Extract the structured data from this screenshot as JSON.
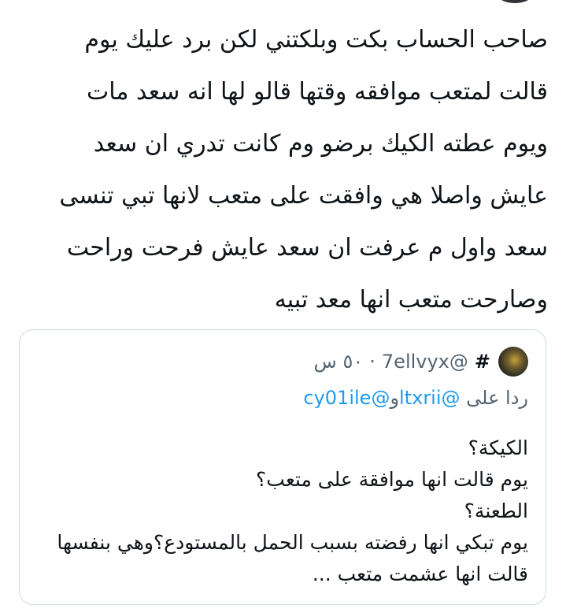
{
  "tweet": {
    "text": "صاحب الحساب بكت وبلكتني لكن برد عليك يوم\nقالت لمتعب موافقه وقتها قالو لها انه سعد مات\nويوم عطته الكيك برضو وم كانت تدري ان سعد\nعايش واصلا هي وافقت على متعب لانها تبي تنسى\nسعد واول م عرفت ان سعد عايش فرحت وراحت\nوصارحت متعب انها معد تبيه"
  },
  "quote": {
    "author_name": "#",
    "author_handle": "@7ellvyx",
    "separator": "·",
    "time": "٥٠ س",
    "reply_prefix": "ردا على",
    "reply_mention_1": "@ltxrii",
    "reply_joiner": "و",
    "reply_mention_2": "@cy01ile",
    "body": "الكيكة؟\nيوم قالت انها موافقة على متعب؟\nالطعنة؟\nيوم تبكي انها رفضته بسبب الحمل بالمستودع؟وهي بنفسها\nقالت انها عشمت متعب ..."
  },
  "colors": {
    "text": "#0f1419",
    "secondary": "#536471",
    "link": "#1d9bf0",
    "border": "#cfd9de"
  }
}
